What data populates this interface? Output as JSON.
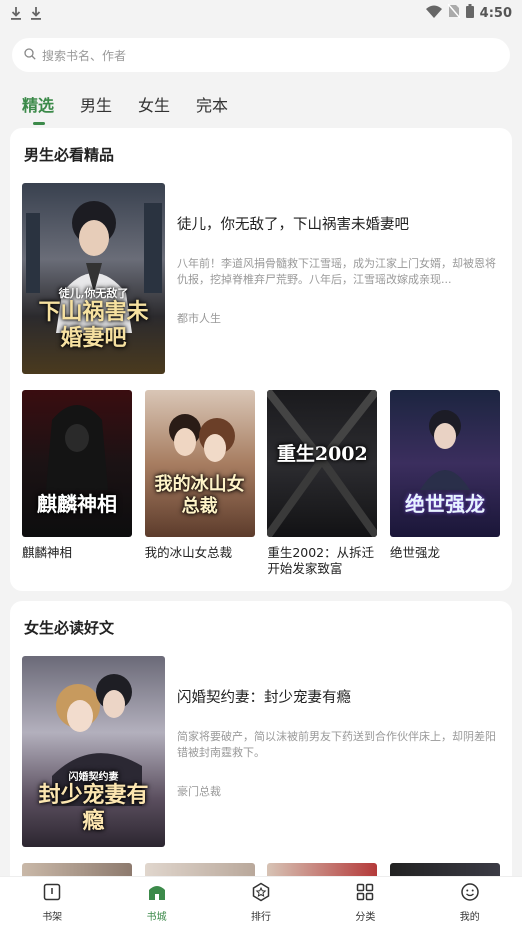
{
  "status": {
    "time": "4:50"
  },
  "search": {
    "placeholder": "搜索书名、作者"
  },
  "tabs": [
    {
      "label": "精选",
      "active": true
    },
    {
      "label": "男生"
    },
    {
      "label": "女生"
    },
    {
      "label": "完本"
    }
  ],
  "sections": [
    {
      "title": "男生必看精品",
      "feature": {
        "title": "徒儿，你无敌了，下山祸害未婚妻吧",
        "desc": "八年前！李道风捐骨髓救下江雪瑶，成为江家上门女婿，却被恩将仇报，挖掉脊椎弃尸荒野。八年后，江雪瑶改嫁成亲现...",
        "tag": "都市人生",
        "cover_text": "下山祸害未婚妻吧",
        "cover_sub": "徒儿,你无敌了"
      },
      "books": [
        {
          "title": "麒麟神相",
          "cover_text": "麒麟神相"
        },
        {
          "title": "我的冰山女总裁",
          "cover_text": "我的冰山女总裁"
        },
        {
          "title": "重生2002：从拆迁开始发家致富",
          "cover_text": "重生2002"
        },
        {
          "title": "绝世强龙",
          "cover_text": "绝世强龙"
        }
      ]
    },
    {
      "title": "女生必读好文",
      "feature": {
        "title": "闪婚契约妻：封少宠妻有瘾",
        "desc": "简家将要破产，简以沫被前男友下药送到合作伙伴床上，却阴差阳错被封南霆救下。",
        "tag": "豪门总裁",
        "cover_text": "封少宠妻有瘾",
        "cover_sub": "闪婚契约妻"
      }
    }
  ],
  "nav": [
    {
      "label": "书架",
      "icon": "bookshelf-icon"
    },
    {
      "label": "书城",
      "icon": "bookstore-icon",
      "active": true
    },
    {
      "label": "排行",
      "icon": "ranking-icon"
    },
    {
      "label": "分类",
      "icon": "category-icon"
    },
    {
      "label": "我的",
      "icon": "profile-icon"
    }
  ],
  "colors": {
    "accent": "#3c8a4a"
  }
}
